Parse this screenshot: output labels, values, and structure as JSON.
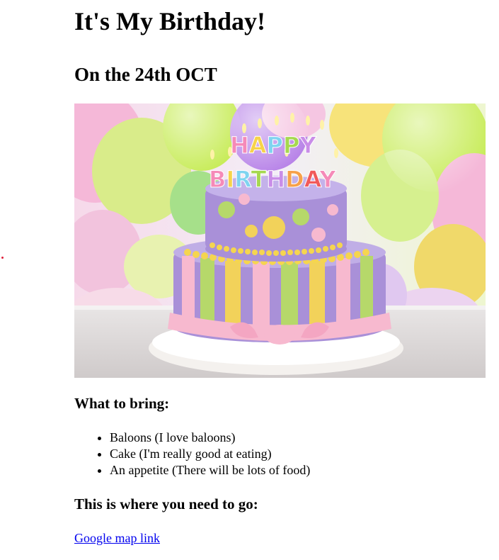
{
  "page": {
    "title": "It's My Birthday!",
    "date_heading": "On the 24th OCT"
  },
  "hero_image": {
    "icon": "birthday-cake-image",
    "cake_topper_line1": "HAPPY",
    "cake_topper_line2": "BIRTHDAY",
    "colors": {
      "balloon_green": "#c8ec5a",
      "balloon_purple": "#b884e8",
      "balloon_pink": "#f5b8d8",
      "balloon_yellow": "#f7e37a",
      "cake_purple": "#a990d8",
      "stripe_yellow": "#f2d25a",
      "stripe_green": "#b6d86a",
      "ribbon_pink": "#f7b9cf"
    }
  },
  "bring": {
    "heading": "What to bring:",
    "items": [
      "Baloons (I love baloons)",
      "Cake (I'm really good at eating)",
      "An appetite (There will be lots of food)"
    ]
  },
  "directions": {
    "heading": "This is where you need to go:",
    "link_text": "Google map link"
  }
}
